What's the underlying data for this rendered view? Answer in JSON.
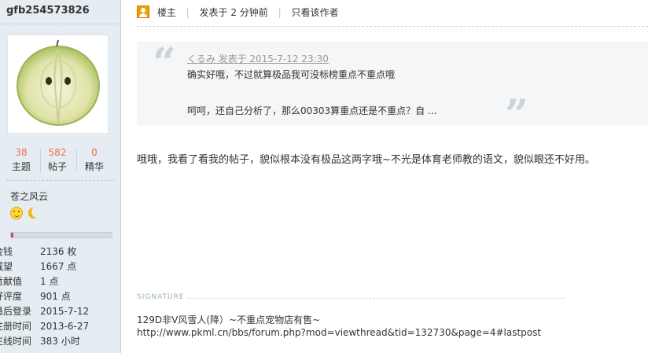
{
  "user": {
    "name": "gfb254573826",
    "stats": [
      {
        "value": "38",
        "label": "主题"
      },
      {
        "value": "582",
        "label": "帖子"
      },
      {
        "value": "0",
        "label": "精华"
      }
    ],
    "group": "苍之风云",
    "medals": [
      "sun-medal-icon",
      "moon-medal-icon"
    ],
    "level_progress": 0.02,
    "info": [
      {
        "key": "金钱",
        "value": "2136 枚"
      },
      {
        "key": "威望",
        "value": "1667 点"
      },
      {
        "key": "贡献值",
        "value": "1 点"
      },
      {
        "key": "好评度",
        "value": "901 点"
      },
      {
        "key": "最后登录",
        "value": "2015-7-12"
      },
      {
        "key": "注册时间",
        "value": "2013-6-27"
      },
      {
        "key": "在线时间",
        "value": "383 小时"
      }
    ]
  },
  "post": {
    "floor_label": "楼主",
    "posted_text": "发表于  2 分钟前",
    "only_author": "只看该作者",
    "quote": {
      "meta": "くるみ 发表于  2015-7-12 23:30",
      "line1": "确实好哦，不过就算极品我可没标榜重点不重点哦",
      "line2": "呵呵，还自己分析了，那么00303算重点还是不重点？自  ..."
    },
    "body": "哦哦，我看了看我的帖子，貌似根本没有极品这两字哦~不光是体育老师教的语文，貌似眼还不好用。",
    "signature_label": "SIGNATURE",
    "signature_text": "129D非V风雪人(降）~不重点宠物店有售~",
    "signature_url": "http://www.pkml.cn/bbs/forum.php?mod=viewthread&tid=132730&page=4#lastpost"
  },
  "colors": {
    "sidebar_bg": "#e5edf2",
    "stat_number": "#f26c4f",
    "progress_fill": "#e63b7a",
    "quote_bg": "#f5f6f7"
  }
}
